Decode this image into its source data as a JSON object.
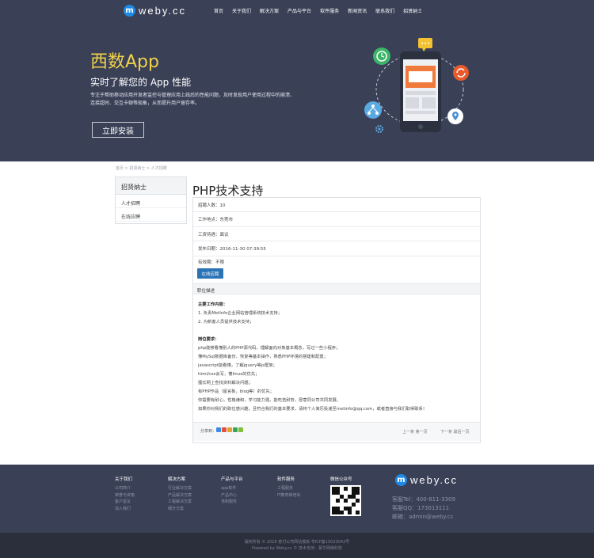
{
  "header": {
    "logo_mark": "m",
    "logo_text": "weby.cc",
    "nav": [
      "首页",
      "关于我们",
      "解决方案",
      "产品与平台",
      "软件服务",
      "新闻资讯",
      "联系我们",
      "招贤纳士"
    ]
  },
  "hero": {
    "title": "西数App",
    "subtitle": "实时了解您的 App 性能",
    "desc_lines": [
      "专注于帮助移动应用开发者监控与管理应用上线后的性能问题，及时发现用户使用过程中的崩溃、",
      "连接超时、交互卡顿等现象，从而提升用户留存率。"
    ],
    "install_label": "立即安装",
    "illustration_icons": [
      "clock-icon",
      "chat-icon",
      "refresh-icon",
      "share-icon",
      "location-icon",
      "gear-icon",
      "phone-icon"
    ]
  },
  "breadcrumb": "首页 > 招贤纳士 > 人才招聘",
  "sidebar": {
    "title": "招贤纳士",
    "items": [
      "人才招聘",
      "在线应聘"
    ]
  },
  "job": {
    "title": "PHP技术支持",
    "fields": [
      "招聘人数：10",
      "工作地点：东莞市",
      "工资待遇：面议",
      "发布日期：2016-11-30 07:39:55",
      "有效期：不限"
    ],
    "apply_label": "在线应聘",
    "section_label": "职位描述",
    "description": [
      {
        "text": "主要工作内容：",
        "bold": true
      },
      {
        "text": "1. 负责MetInfo企业网站管理系统技术支持；",
        "bold": false
      },
      {
        "text": "2. 为新客人员提供技术支持；",
        "bold": false
      },
      {
        "text": "",
        "bold": false
      },
      {
        "text": "岗位要求：",
        "bold": true
      },
      {
        "text": "php能够看懂别人的PHP源代码，理解面向对象基本概念，写过一些小程序；",
        "bold": false
      },
      {
        "text": "懂MySql数据库备份、恢复等基本操作，熟悉PHP环境的搭建和配置；",
        "bold": false
      },
      {
        "text": "javascript能看懂，了解jquery等js框架；",
        "bold": false
      },
      {
        "text": "html/css会写，懂linux的优先；",
        "bold": false
      },
      {
        "text": "擅长网上查找资料解决问题；",
        "bold": false
      },
      {
        "text": "有PHP作品（留言板，blog等）的优先；",
        "bold": false
      },
      {
        "text": "你需要有耐心，性格谦和，学习能力强，能吃苦耐劳，愿意同公司共同发展。",
        "bold": false
      },
      {
        "text": "如果你对我们的职位感兴趣，且符合我们的基本要求，请将个人简历投递至metinfo@qq.com，或者直接与我们取得联系！",
        "bold": false
      }
    ],
    "share_label": "分享到：",
    "share_colors": [
      "#3b8be0",
      "#e0533a",
      "#e8a02c",
      "#3aa35a",
      "#7fbf3a"
    ],
    "prev_label": "上一条",
    "prev_value": "第一页",
    "next_label": "下一条",
    "next_value": "最后一页"
  },
  "footer": {
    "columns": [
      {
        "title": "关于我们",
        "items": [
          "公司简介",
          "荣誉与资格",
          "客户留言",
          "加入我们"
        ]
      },
      {
        "title": "解决方案",
        "items": [
          "行业解决方案",
          "产品解决方案",
          "工程解决方案",
          "细分方案"
        ]
      },
      {
        "title": "产品与平台",
        "items": [
          "app软件",
          "产品中心",
          "该和服务"
        ]
      },
      {
        "title": "软件服务",
        "items": [
          "工程服务",
          "IT教育和培训"
        ]
      }
    ],
    "wechat_title": "微信公众号",
    "logo_mark": "m",
    "logo_text": "weby.cc",
    "contact": [
      "客服Tel：400-811-3309",
      "客服QQ：173013111",
      "邮箱：admin@weby.cc"
    ],
    "copyright": [
      "版权所有 © 2016 者付公司网站模板 粤ICP备15023042号",
      "Powered by Weby.cc © 技术支持：蒙尔网络科技"
    ]
  }
}
